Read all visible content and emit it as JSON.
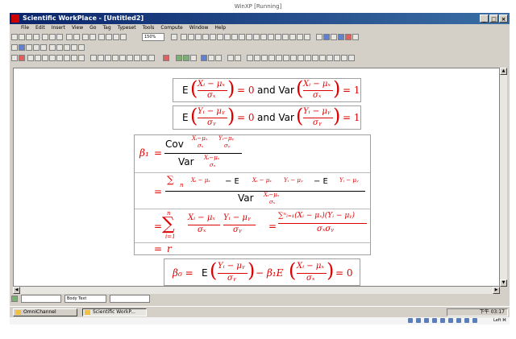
{
  "host_title": "WinXP [Running]",
  "app": {
    "title": "Scientific WorkPlace - [Untitled2]",
    "window_buttons": [
      "_",
      "□",
      "×"
    ],
    "inner_window_buttons": [
      "_",
      "□",
      "×"
    ]
  },
  "menu": [
    "File",
    "Edit",
    "Insert",
    "View",
    "Go",
    "Tag",
    "Typeset",
    "Tools",
    "Compute",
    "Window",
    "Help"
  ],
  "toolbar": {
    "zoom": "150%"
  },
  "equations": {
    "eq1": {
      "E": "E",
      "and_var": "and Var",
      "num": "Xᵢ − μₓ",
      "den": "σₓ",
      "eq0": "= 0",
      "eq1": "= 1"
    },
    "eq2": {
      "E": "E",
      "and_var": "and Var",
      "num": "Yᵢ − μᵧ",
      "den": "σᵧ",
      "eq0": "= 0",
      "eq1": "= 1"
    },
    "beta1": {
      "lhs": "β₁",
      "eq": "=",
      "cov": "Cov",
      "var": "Var",
      "arg_x_num": "Xᵢ−μₓ",
      "arg_x_den": "σₓ",
      "arg_y_num": "Yᵢ−μᵧ",
      "arg_y_den": "σᵧ",
      "sum": "∑",
      "sum_upper": "n",
      "sum_lower": "i=1",
      "minus_E": "− E",
      "frac_num_xy": "Xᵢ − μₓ",
      "frac_num_y": "Yᵢ − μᵧ",
      "frac_den_x": "σₓ",
      "frac_den_y": "σᵧ",
      "line3_rhs_num": "∑ⁿᵢ₌₁(Xᵢ − μₓ)(Yᵢ − μᵧ)",
      "line3_rhs_den": "σₓσᵧ",
      "r": "r"
    },
    "beta0": {
      "lhs": "β₀ =",
      "E": "E",
      "minus_beta1": "− β₁E",
      "eq0": "= 0"
    }
  },
  "status": {
    "style": "Body Text",
    "field1": "",
    "field3": ""
  },
  "taskbar": {
    "tasks": [
      "OmniChannel",
      "Scientific WorkP..."
    ],
    "clock": "下午 03:17"
  },
  "vm_status": {
    "label": "Left ⌘"
  }
}
